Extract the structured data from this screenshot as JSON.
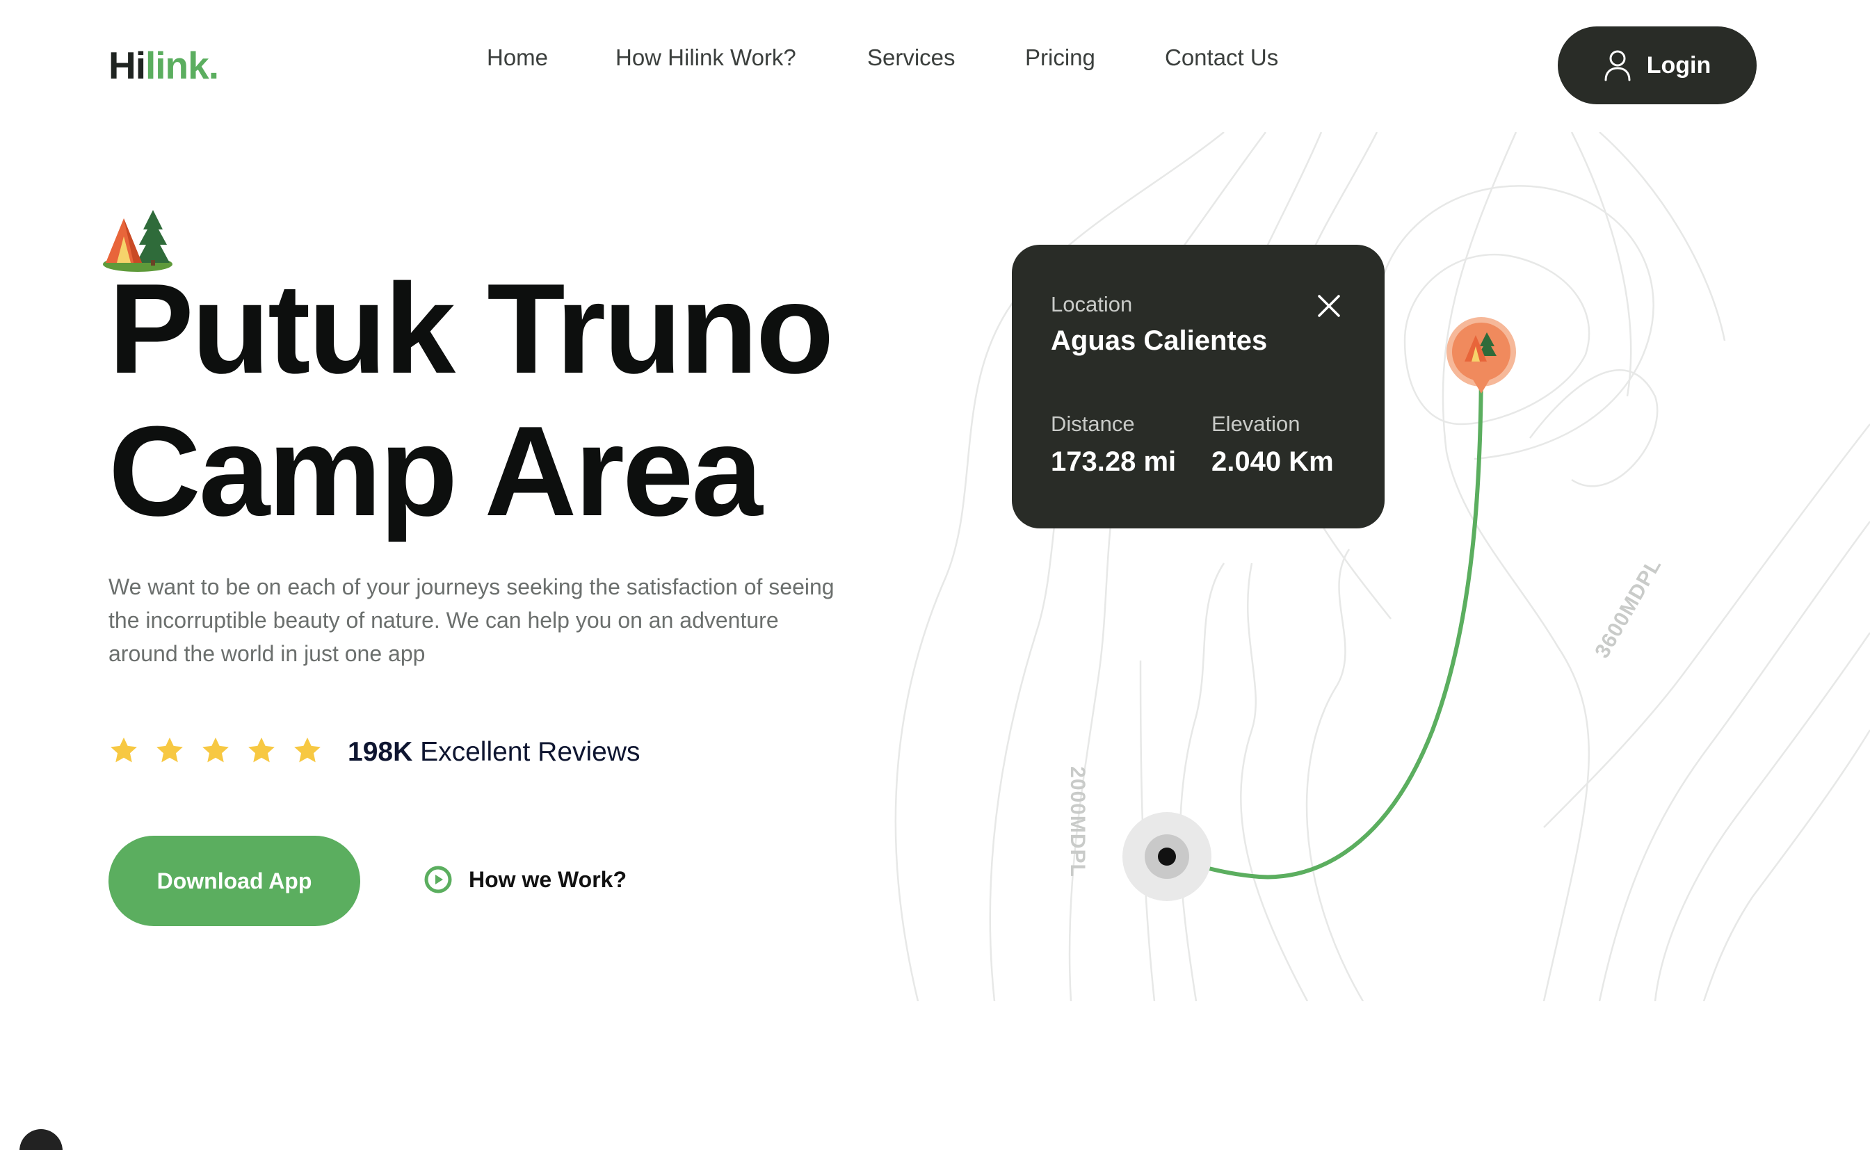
{
  "brand": {
    "part1": "Hi",
    "part2": "link",
    "part3": "."
  },
  "nav": {
    "items": [
      {
        "label": "Home"
      },
      {
        "label": "How Hilink Work?"
      },
      {
        "label": "Services"
      },
      {
        "label": "Pricing"
      },
      {
        "label": "Contact Us"
      }
    ],
    "login_label": "Login",
    "login_icon": "user-icon"
  },
  "hero": {
    "title_line1": "Putuk Truno",
    "title_line2": "Camp Area",
    "description": "We want to be on each of your journeys seeking the satisfaction of seeing the incorruptible beauty of nature. We can help you on an adventure around the world in just one app",
    "rating_stars": 5,
    "reviews_count": "198K",
    "reviews_label": "Excellent Reviews",
    "download_label": "Download App",
    "how_label": "How we Work?",
    "how_icon": "play-icon",
    "emoji_icon": "camping-tent-icon"
  },
  "location_card": {
    "location_label": "Location",
    "location_value": "Aguas Calientes",
    "distance_label": "Distance",
    "distance_value": "173.28 mi",
    "elevation_label": "Elevation",
    "elevation_value": "2.040 Km",
    "close_icon": "close-icon"
  },
  "map": {
    "contour_label_a": "3600MDPL",
    "contour_label_b": "2000MDPL",
    "route_color": "#5bae5f",
    "pin_color": "#f08a5d"
  },
  "colors": {
    "accent": "#5bae5f",
    "dark": "#292c27",
    "star": "#f7c842"
  }
}
